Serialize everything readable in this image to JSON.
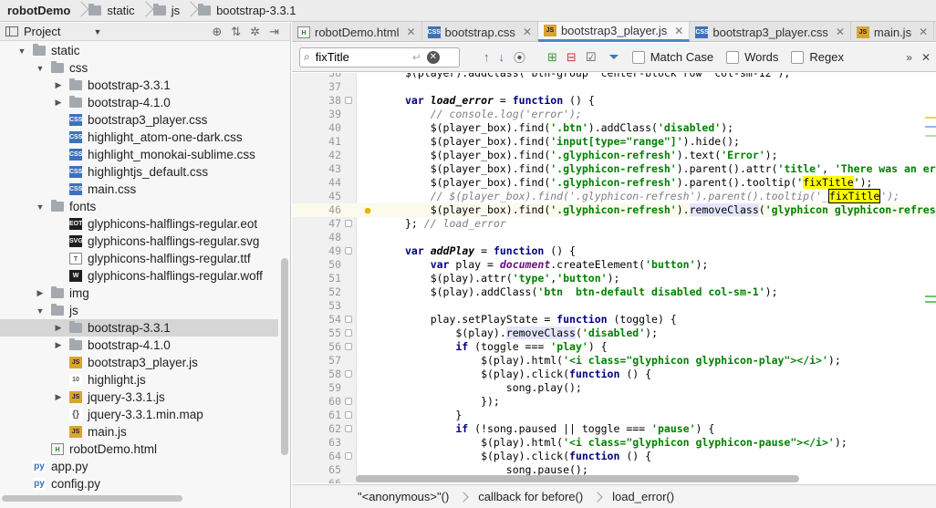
{
  "breadcrumb": [
    "robotDemo",
    "static",
    "js",
    "bootstrap-3.3.1"
  ],
  "project": {
    "title": "Project",
    "tree": [
      {
        "label": "static",
        "type": "folder",
        "depth": 1,
        "open": true
      },
      {
        "label": "css",
        "type": "folder",
        "depth": 2,
        "open": true
      },
      {
        "label": "bootstrap-3.3.1",
        "type": "folder",
        "depth": 3,
        "open": false
      },
      {
        "label": "bootstrap-4.1.0",
        "type": "folder",
        "depth": 3,
        "open": false
      },
      {
        "label": "bootstrap3_player.css",
        "type": "css",
        "depth": 3
      },
      {
        "label": "highlight_atom-one-dark.css",
        "type": "css",
        "depth": 3
      },
      {
        "label": "highlight_monokai-sublime.css",
        "type": "css",
        "depth": 3
      },
      {
        "label": "highlightjs_default.css",
        "type": "css",
        "depth": 3
      },
      {
        "label": "main.css",
        "type": "css",
        "depth": 3
      },
      {
        "label": "fonts",
        "type": "folder",
        "depth": 2,
        "open": true
      },
      {
        "label": "glyphicons-halflings-regular.eot",
        "type": "eot",
        "depth": 3
      },
      {
        "label": "glyphicons-halflings-regular.svg",
        "type": "svgf",
        "depth": 3
      },
      {
        "label": "glyphicons-halflings-regular.ttf",
        "type": "ttf",
        "depth": 3
      },
      {
        "label": "glyphicons-halflings-regular.woff",
        "type": "woff",
        "depth": 3
      },
      {
        "label": "img",
        "type": "folder",
        "depth": 2,
        "open": false
      },
      {
        "label": "js",
        "type": "folder",
        "depth": 2,
        "open": true
      },
      {
        "label": "bootstrap-3.3.1",
        "type": "folder",
        "depth": 3,
        "open": false,
        "selected": true
      },
      {
        "label": "bootstrap-4.1.0",
        "type": "folder",
        "depth": 3,
        "open": false
      },
      {
        "label": "bootstrap3_player.js",
        "type": "js",
        "depth": 3
      },
      {
        "label": "highlight.js",
        "type": "hl",
        "depth": 3
      },
      {
        "label": "jquery-3.3.1.js",
        "type": "js",
        "depth": 3,
        "expandable": true
      },
      {
        "label": "jquery-3.3.1.min.map",
        "type": "map",
        "depth": 3
      },
      {
        "label": "main.js",
        "type": "js",
        "depth": 3
      },
      {
        "label": "robotDemo.html",
        "type": "html",
        "depth": 2
      },
      {
        "label": "app.py",
        "type": "py",
        "depth": 1
      },
      {
        "label": "config.py",
        "type": "py",
        "depth": 1
      }
    ]
  },
  "tabs": [
    {
      "label": "robotDemo.html",
      "type": "html"
    },
    {
      "label": "bootstrap.css",
      "type": "css"
    },
    {
      "label": "bootstrap3_player.js",
      "type": "js",
      "active": true
    },
    {
      "label": "bootstrap3_player.css",
      "type": "css"
    },
    {
      "label": "main.js",
      "type": "js"
    }
  ],
  "tabs_overflow": "4",
  "find": {
    "query": "fixTitle",
    "match_case": "Match Case",
    "words": "Words",
    "regex": "Regex"
  },
  "editor": {
    "first_line": 36,
    "current_line": 46,
    "lines": [
      [
        [
          "",
          "$(player).addClass('btn-group  center-block row  col-sm-12');"
        ]
      ],
      [
        [
          "",
          ""
        ]
      ],
      [
        [
          "kw",
          "var "
        ],
        [
          "fn",
          "load_error"
        ],
        [
          "",
          " = "
        ],
        [
          "kw",
          "function"
        ],
        [
          "",
          " () {"
        ]
      ],
      [
        [
          "cmt",
          "    // console.log('error');"
        ]
      ],
      [
        [
          "",
          "    $(player_box).find("
        ],
        [
          "str",
          "'.btn'"
        ],
        [
          "",
          ").addClass("
        ],
        [
          "str",
          "'disabled'"
        ],
        [
          "",
          ");"
        ]
      ],
      [
        [
          "",
          "    $(player_box).find("
        ],
        [
          "str",
          "'input[type=\"range\"]'"
        ],
        [
          "",
          ").hide();"
        ]
      ],
      [
        [
          "",
          "    $(player_box).find("
        ],
        [
          "str",
          "'.glyphicon-refresh'"
        ],
        [
          "",
          ").text("
        ],
        [
          "str",
          "'Error'"
        ],
        [
          "",
          ");"
        ]
      ],
      [
        [
          "",
          "    $(player_box).find("
        ],
        [
          "str",
          "'.glyphicon-refresh'"
        ],
        [
          "",
          ").parent().attr("
        ],
        [
          "str",
          "'title'"
        ],
        [
          "",
          ", "
        ],
        [
          "str",
          "'There was an error"
        ]
      ],
      [
        [
          "",
          "    $(player_box).find("
        ],
        [
          "str",
          "'.glyphicon-refresh'"
        ],
        [
          "",
          ").parent().tooltip("
        ],
        [
          "str",
          "'"
        ],
        [
          "hit",
          "fixTitle"
        ],
        [
          "str",
          "'"
        ],
        [
          "",
          ");"
        ]
      ],
      [
        [
          "cmt",
          "    // $(player_box).find('.glyphicon-refresh').parent().tooltip('_"
        ],
        [
          "hitbox",
          "fixTitle"
        ],
        [
          "cmt",
          "');"
        ]
      ],
      [
        [
          "",
          "    $(player_box).find("
        ],
        [
          "str",
          "'.glyphicon-refresh'"
        ],
        [
          "",
          ")."
        ],
        [
          "usage",
          "removeClass"
        ],
        [
          "",
          "("
        ],
        [
          "str",
          "'glyphicon glyphicon-refresh"
        ]
      ],
      [
        [
          "",
          "}; "
        ],
        [
          "cmt",
          "// load_error"
        ]
      ],
      [
        [
          "",
          ""
        ]
      ],
      [
        [
          "kw",
          "var "
        ],
        [
          "fn",
          "addPlay"
        ],
        [
          "",
          " = "
        ],
        [
          "kw",
          "function"
        ],
        [
          "",
          " () {"
        ]
      ],
      [
        [
          "kw",
          "    var "
        ],
        [
          "",
          "play = "
        ],
        [
          "doc",
          "document"
        ],
        [
          "",
          ".createElement("
        ],
        [
          "str",
          "'button'"
        ],
        [
          "",
          ");"
        ]
      ],
      [
        [
          "",
          "    $(play).attr("
        ],
        [
          "str",
          "'type'"
        ],
        [
          "",
          ","
        ],
        [
          "str",
          "'button'"
        ],
        [
          "",
          ");"
        ]
      ],
      [
        [
          "",
          "    $(play).addClass("
        ],
        [
          "str",
          "'btn  btn-default disabled col-sm-1'"
        ],
        [
          "",
          ");"
        ]
      ],
      [
        [
          "",
          ""
        ]
      ],
      [
        [
          "",
          "    play.setPlayState = "
        ],
        [
          "kw",
          "function"
        ],
        [
          "",
          " (toggle) {"
        ]
      ],
      [
        [
          "",
          "        $(play)."
        ],
        [
          "usage",
          "removeClass"
        ],
        [
          "",
          "("
        ],
        [
          "str",
          "'disabled'"
        ],
        [
          "",
          ");"
        ]
      ],
      [
        [
          "kw",
          "        if"
        ],
        [
          "",
          " (toggle === "
        ],
        [
          "str",
          "'play'"
        ],
        [
          "",
          ") {"
        ]
      ],
      [
        [
          "",
          "            $(play).html("
        ],
        [
          "str",
          "'<i class=\"glyphicon glyphicon-play\"></i>'"
        ],
        [
          "",
          ");"
        ]
      ],
      [
        [
          "",
          "            $(play).click("
        ],
        [
          "kw",
          "function"
        ],
        [
          "",
          " () {"
        ]
      ],
      [
        [
          "",
          "                song.play();"
        ]
      ],
      [
        [
          "",
          "            });"
        ]
      ],
      [
        [
          "",
          "        }"
        ]
      ],
      [
        [
          "kw",
          "        if"
        ],
        [
          "",
          " (!song.paused || toggle === "
        ],
        [
          "str",
          "'pause'"
        ],
        [
          "",
          ") {"
        ]
      ],
      [
        [
          "",
          "            $(play).html("
        ],
        [
          "str",
          "'<i class=\"glyphicon glyphicon-pause\"></i>'"
        ],
        [
          "",
          ");"
        ]
      ],
      [
        [
          "",
          "            $(play).click("
        ],
        [
          "kw",
          "function"
        ],
        [
          "",
          " () {"
        ]
      ],
      [
        [
          "",
          "                song.pause();"
        ]
      ],
      [
        [
          "",
          ""
        ]
      ]
    ]
  },
  "status": [
    "\"<anonymous>\"()",
    "callback for before()",
    "load_error()"
  ],
  "colors": {
    "accent": "#4d85d1",
    "highlight": "#ffff00",
    "selection": "#d5d5d5"
  }
}
